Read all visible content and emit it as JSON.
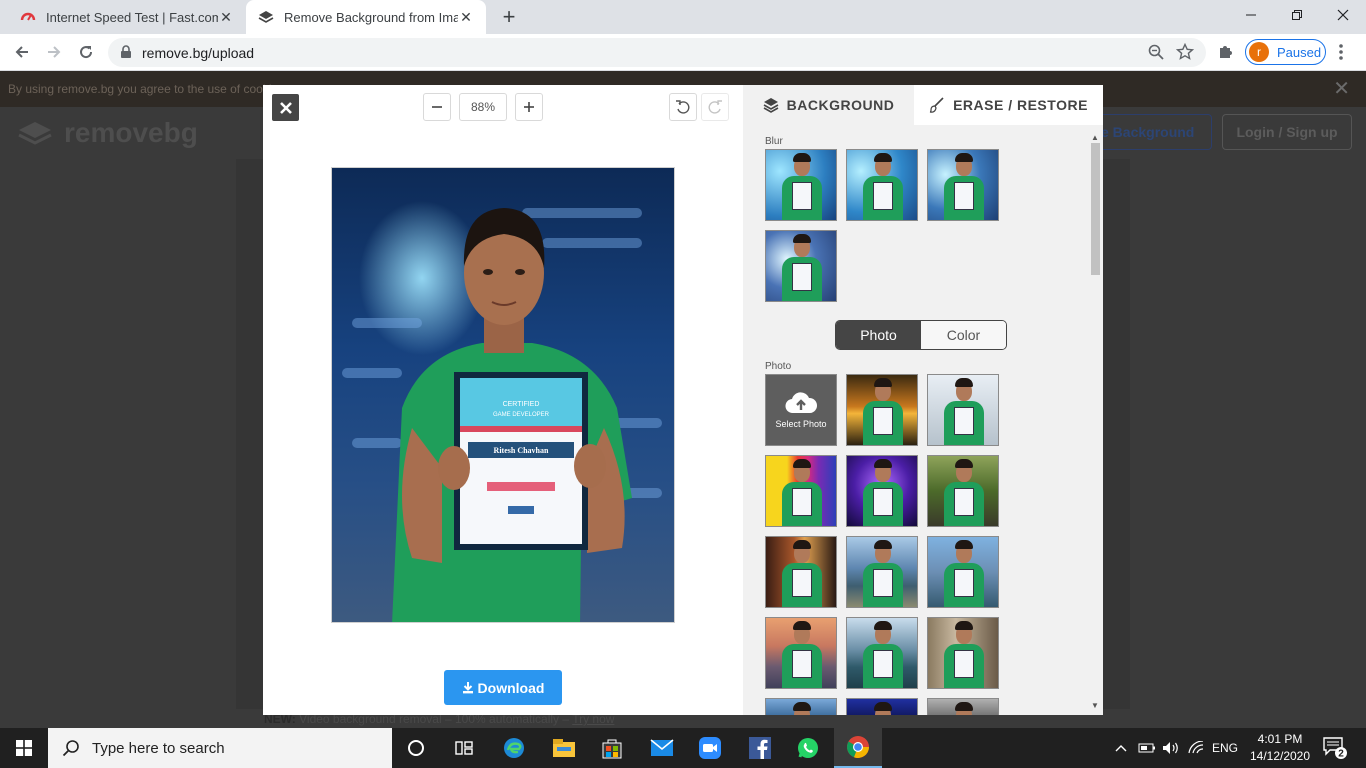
{
  "browser": {
    "tabs": [
      {
        "title": "Internet Speed Test | Fast.com",
        "icon": "fast-com-icon"
      },
      {
        "title": "Remove Background from Image",
        "icon": "remove-bg-icon"
      }
    ],
    "url": "remove.bg/upload",
    "profile": {
      "initial": "r",
      "status": "Paused"
    }
  },
  "site": {
    "cookie_text": "By using remove.bg you agree to the use of cookies",
    "logo_text": "removebg",
    "remove_bg_btn": "e Background",
    "login_btn": "Login / Sign up",
    "footer_new": "NEW:",
    "footer_text": " Video background removal – 100% automatically – ",
    "footer_link": "Try now"
  },
  "editor": {
    "zoom_value": "88%",
    "download_label": "Download",
    "preview_cert": {
      "certified": "CERTIFIED",
      "title": "GAME DEVELOPER",
      "name": "Ritesh Chavhan"
    },
    "tabs": {
      "background": "BACKGROUND",
      "erase": "ERASE / RESTORE"
    },
    "blur_label": "Blur",
    "toggle": {
      "photo": "Photo",
      "color": "Color"
    },
    "photo_label": "Photo",
    "select_photo": "Select Photo",
    "blur_thumbs": [
      "#2d7fc1",
      "#2f87c9",
      "#3b78b9",
      "#4a73b5"
    ],
    "photo_thumbs": [
      "sunset-palm",
      "white-studio",
      "rainbow-stripes",
      "purple-lights",
      "forest-road",
      "city-night",
      "mountain-lake",
      "city-skyline",
      "beach-sunset",
      "lake-mountains",
      "street-buildings"
    ]
  },
  "taskbar": {
    "search_placeholder": "Type here to search",
    "language": "ENG",
    "time": "4:01 PM",
    "date": "14/12/2020",
    "notification_count": "2"
  },
  "colors": {
    "download_blue": "#2b96f0",
    "profile_blue": "#1a73e8",
    "profile_avatar": "#e8710a"
  }
}
